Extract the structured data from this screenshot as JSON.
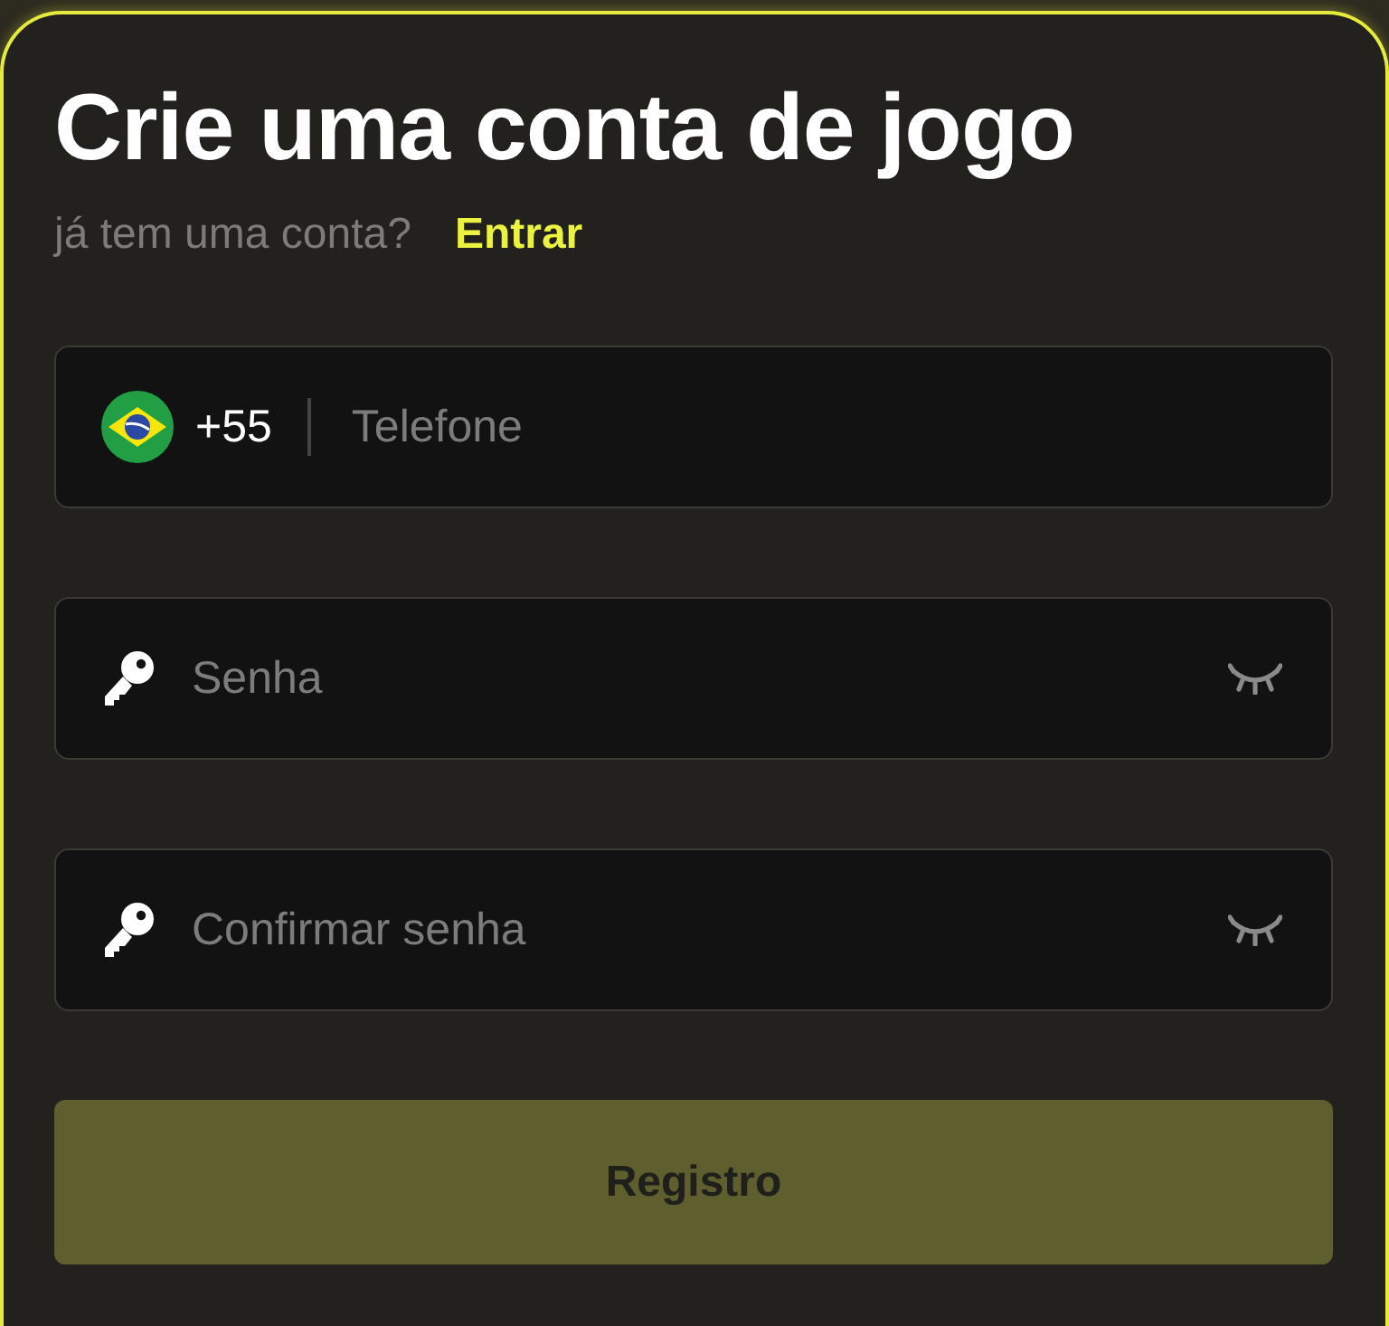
{
  "title": "Crie uma conta de jogo",
  "login_prompt": {
    "text": "já tem uma conta?",
    "link": "Entrar"
  },
  "fields": [
    {
      "kind": "phone",
      "country_code": "+55",
      "placeholder": "Telefone"
    },
    {
      "kind": "password",
      "placeholder": "Senha"
    },
    {
      "kind": "password",
      "placeholder": "Confirmar senha"
    }
  ],
  "submit_button": {
    "label": "Registro",
    "disabled": true
  }
}
